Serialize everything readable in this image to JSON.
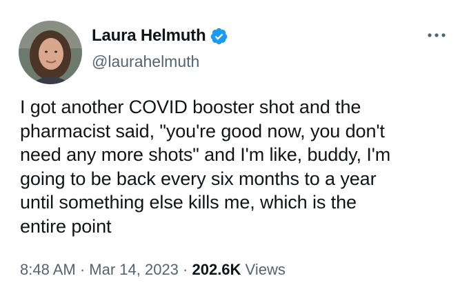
{
  "author": {
    "display_name": "Laura Helmuth",
    "handle": "@laurahelmuth",
    "verified_icon": "verified-badge-icon"
  },
  "tweet": {
    "text": "I got another COVID booster shot and the\npharmacist said, \"you're good now, you don't\nneed any more shots\" and I'm like, buddy, I'm\ngoing to be back every six months to a year\nuntil something else kills me, which is the\nentire point",
    "time": "8:48 AM",
    "separator_1": " · ",
    "date": "Mar 14, 2023",
    "separator_2": " · ",
    "views_count": "202.6K",
    "views_label": " Views"
  },
  "icons": {
    "more": "more-options-icon"
  },
  "colors": {
    "verified_blue": "#1d9bf0",
    "text_primary": "#0f1419",
    "text_secondary": "#536471"
  }
}
